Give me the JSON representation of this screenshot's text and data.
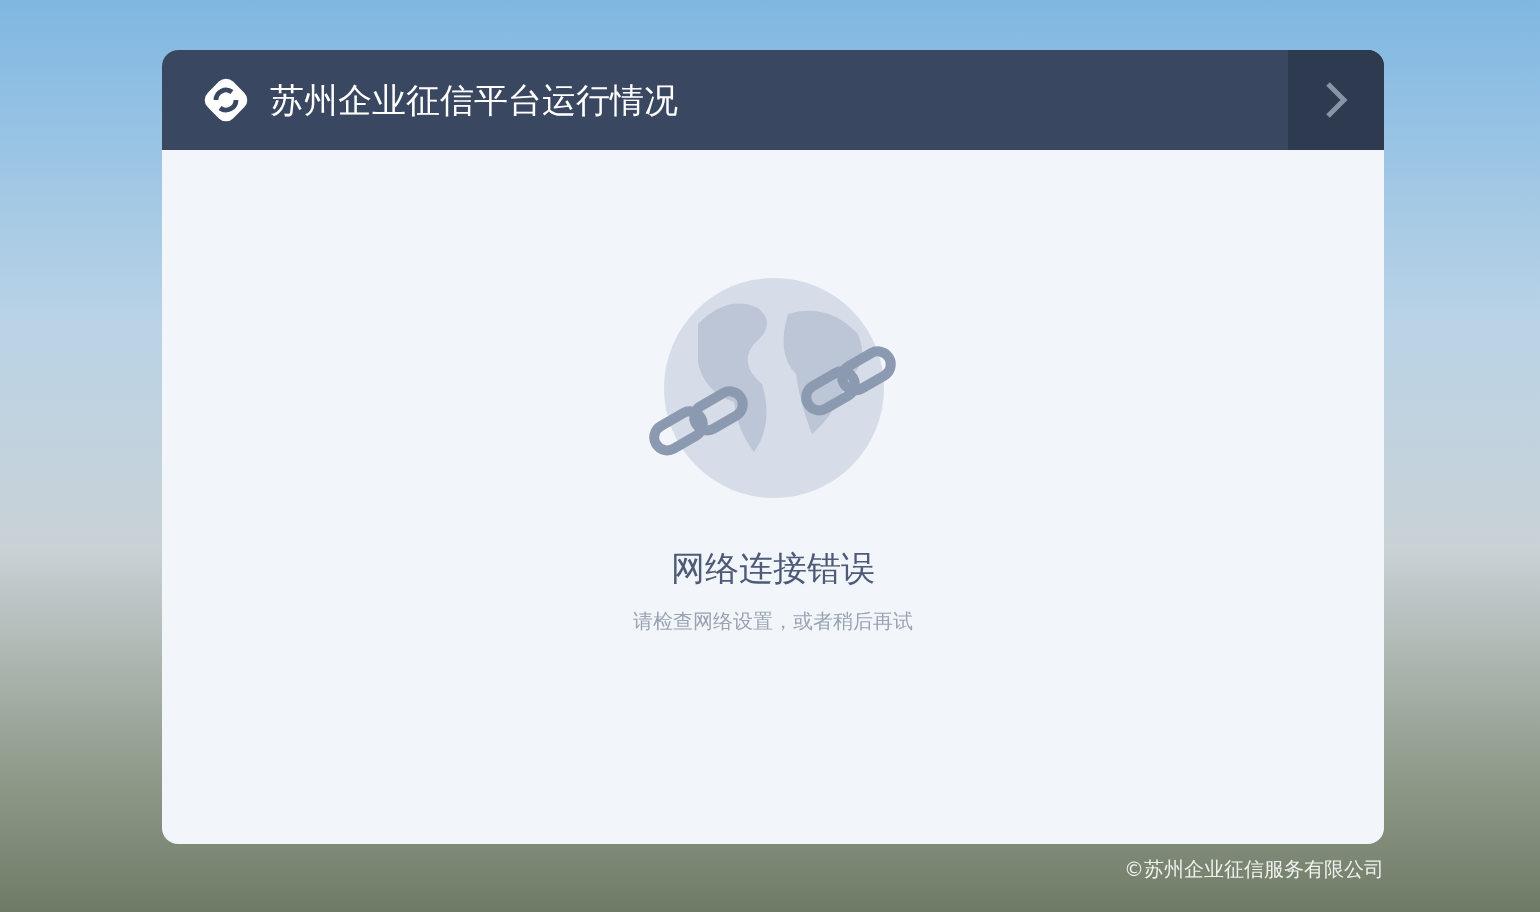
{
  "header": {
    "title": "苏州企业征信平台运行情况"
  },
  "error": {
    "title": "网络连接错误",
    "message": "请检查网络设置，或者稍后再试"
  },
  "footer": {
    "copyright": "©苏州企业征信服务有限公司"
  }
}
